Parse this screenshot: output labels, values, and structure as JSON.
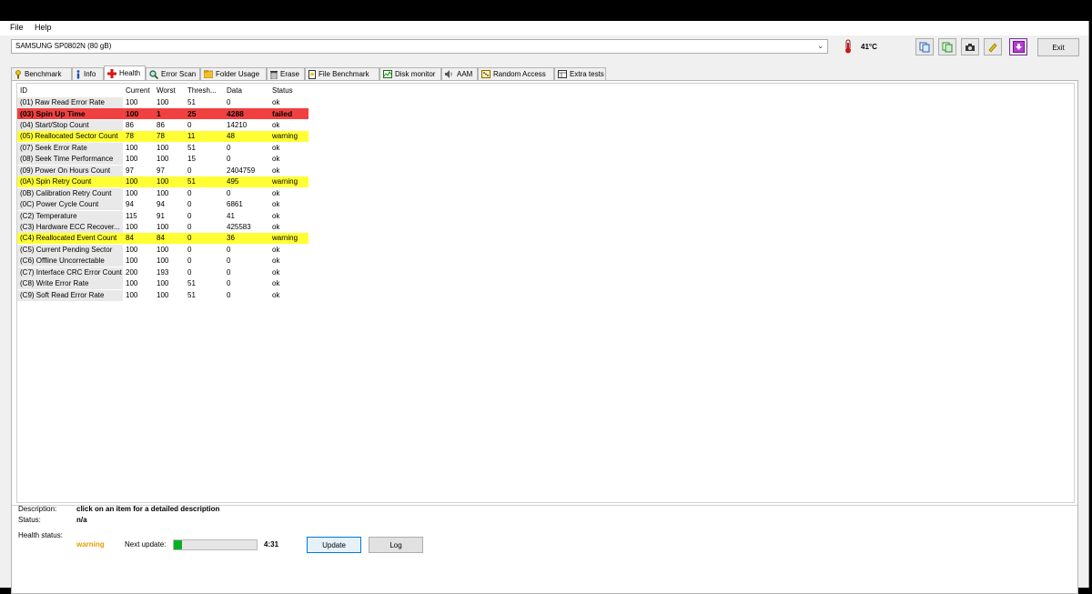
{
  "menu": {
    "file": "File",
    "help": "Help"
  },
  "drive": {
    "selected": "SAMSUNG SP0802N (80 gB)",
    "temperature": "41°C"
  },
  "toolbar": {
    "icons": [
      "copy-icon",
      "copy-all-icon",
      "screenshot-icon",
      "options-icon",
      "save-icon"
    ],
    "exit_label": "Exit"
  },
  "tabs": [
    {
      "label": "Benchmark",
      "icon": "benchmark-icon"
    },
    {
      "label": "Info",
      "icon": "info-icon"
    },
    {
      "label": "Health",
      "icon": "health-icon",
      "active": true
    },
    {
      "label": "Error Scan",
      "icon": "error-scan-icon"
    },
    {
      "label": "Folder Usage",
      "icon": "folder-icon"
    },
    {
      "label": "Erase",
      "icon": "erase-icon"
    },
    {
      "label": "File Benchmark",
      "icon": "file-benchmark-icon"
    },
    {
      "label": "Disk monitor",
      "icon": "disk-monitor-icon"
    },
    {
      "label": "AAM",
      "icon": "speaker-icon"
    },
    {
      "label": "Random Access",
      "icon": "random-access-icon"
    },
    {
      "label": "Extra tests",
      "icon": "extra-tests-icon"
    }
  ],
  "table": {
    "headers": [
      "ID",
      "Current",
      "Worst",
      "Thresh...",
      "Data",
      "Status"
    ],
    "rows": [
      [
        "(01) Raw Read Error Rate",
        "100",
        "100",
        "51",
        "0",
        "ok"
      ],
      [
        "(03) Spin Up Time",
        "100",
        "1",
        "25",
        "4288",
        "failed"
      ],
      [
        "(04) Start/Stop Count",
        "86",
        "86",
        "0",
        "14210",
        "ok"
      ],
      [
        "(05) Reallocated Sector Count",
        "78",
        "78",
        "11",
        "48",
        "warning"
      ],
      [
        "(07) Seek Error Rate",
        "100",
        "100",
        "51",
        "0",
        "ok"
      ],
      [
        "(08) Seek Time Performance",
        "100",
        "100",
        "15",
        "0",
        "ok"
      ],
      [
        "(09) Power On Hours Count",
        "97",
        "97",
        "0",
        "2404759",
        "ok"
      ],
      [
        "(0A) Spin Retry Count",
        "100",
        "100",
        "51",
        "495",
        "warning"
      ],
      [
        "(0B) Calibration Retry Count",
        "100",
        "100",
        "0",
        "0",
        "ok"
      ],
      [
        "(0C) Power Cycle Count",
        "94",
        "94",
        "0",
        "6861",
        "ok"
      ],
      [
        "(C2) Temperature",
        "115",
        "91",
        "0",
        "41",
        "ok"
      ],
      [
        "(C3) Hardware ECC Recover...",
        "100",
        "100",
        "0",
        "425583",
        "ok"
      ],
      [
        "(C4) Reallocated Event Count",
        "84",
        "84",
        "0",
        "36",
        "warning"
      ],
      [
        "(C5) Current Pending Sector",
        "100",
        "100",
        "0",
        "0",
        "ok"
      ],
      [
        "(C6) Offline Uncorrectable",
        "100",
        "100",
        "0",
        "0",
        "ok"
      ],
      [
        "(C7) Interface CRC Error Count",
        "200",
        "193",
        "0",
        "0",
        "ok"
      ],
      [
        "(C8) Write Error Rate",
        "100",
        "100",
        "51",
        "0",
        "ok"
      ],
      [
        "(C9) Soft Read Error Rate",
        "100",
        "100",
        "51",
        "0",
        "ok"
      ]
    ]
  },
  "details": {
    "description_label": "Description:",
    "description": "click on an item for a detailed description",
    "status_label": "Status:",
    "status": "n/a"
  },
  "footer": {
    "health_label": "Health status:",
    "health_value": "warning",
    "next_update_label": "Next update:",
    "next_update_time": "4:31",
    "progress_fraction": 0.1,
    "update_label": "Update",
    "log_label": "Log"
  },
  "colors": {
    "failed": "#f04040",
    "warning": "#ffff33",
    "health_warning_text": "#e6a000"
  }
}
